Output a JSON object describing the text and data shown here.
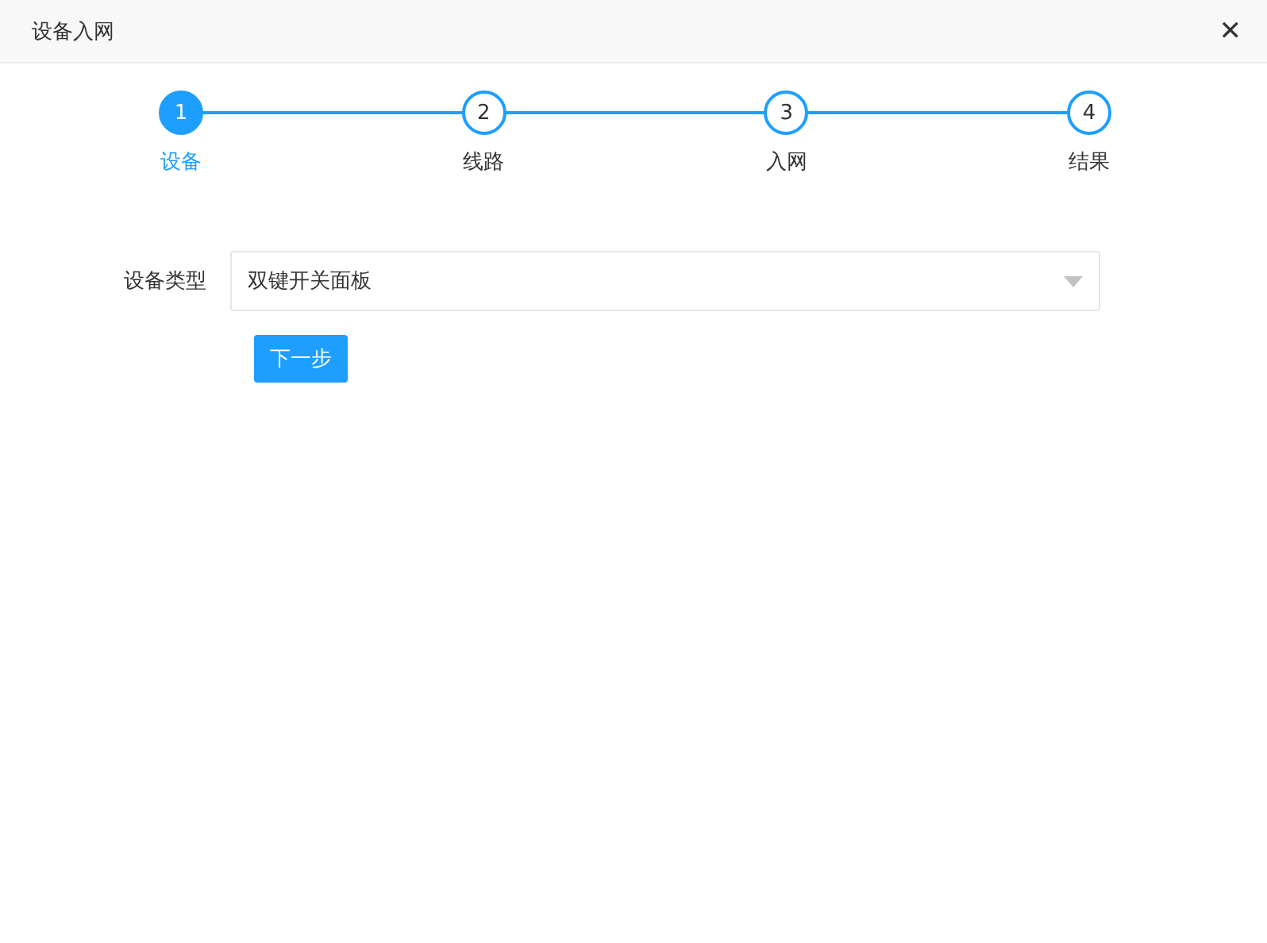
{
  "window": {
    "title": "设备入网",
    "close": "✕"
  },
  "steps": [
    {
      "number": "1",
      "label": "设备",
      "selected": true
    },
    {
      "number": "2",
      "label": "线路",
      "selected": false
    },
    {
      "number": "3",
      "label": "入网",
      "selected": false
    },
    {
      "number": "4",
      "label": "结果",
      "selected": false
    }
  ],
  "form": {
    "label": "设备类型",
    "value": "双键开关面板"
  },
  "buttons": [
    "下一步"
  ]
}
